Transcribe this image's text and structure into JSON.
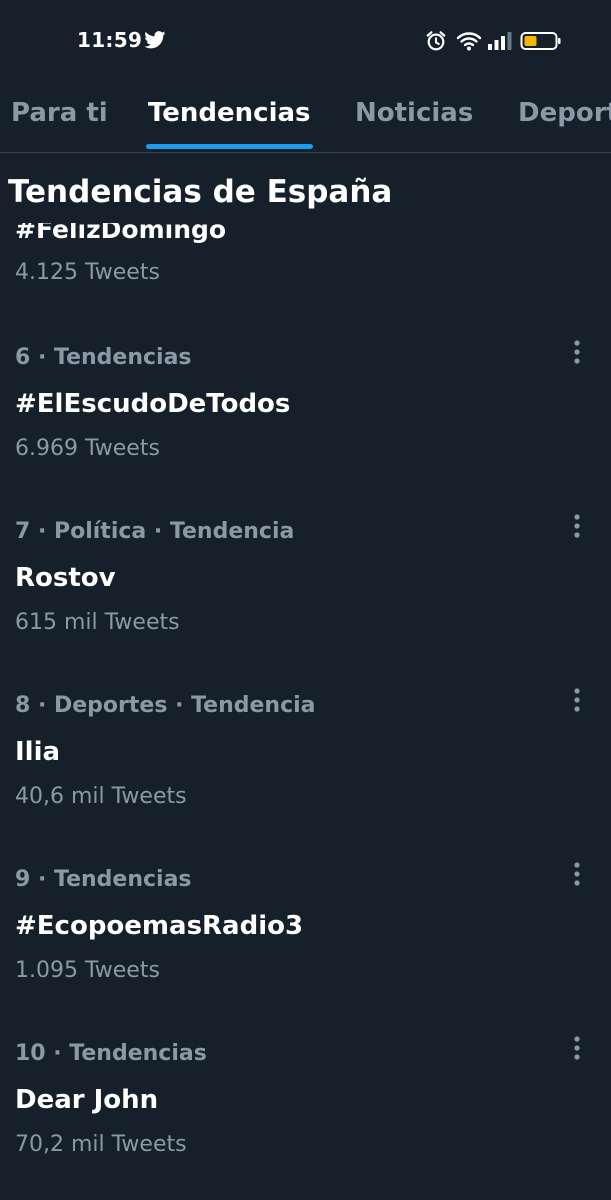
{
  "status_bar": {
    "time": "11:59",
    "icons": [
      "twitter-bird-icon",
      "alarm-icon",
      "wifi-icon",
      "signal-icon",
      "battery-icon"
    ],
    "battery_color": "#f5b800"
  },
  "tabs": [
    {
      "label": "Para ti",
      "active": false
    },
    {
      "label": "Tendencias",
      "active": true
    },
    {
      "label": "Noticias",
      "active": false
    },
    {
      "label": "Deportes",
      "active": false
    }
  ],
  "section_title": "Tendencias de España",
  "partial_trend": {
    "name": "#FelizDomingo",
    "count": "4.125 Tweets"
  },
  "trends": [
    {
      "meta": "6 · Tendencias",
      "name": "#ElEscudoDeTodos",
      "count": "6.969 Tweets"
    },
    {
      "meta": "7 · Política · Tendencia",
      "name": "Rostov",
      "count": "615 mil Tweets"
    },
    {
      "meta": "8 · Deportes · Tendencia",
      "name": "Ilia",
      "count": "40,6 mil Tweets"
    },
    {
      "meta": "9 · Tendencias",
      "name": "#EcopoemasRadio3",
      "count": "1.095 Tweets"
    },
    {
      "meta": "10 · Tendencias",
      "name": "Dear John",
      "count": "70,2 mil Tweets"
    }
  ],
  "colors": {
    "background": "#15202b",
    "accent": "#1d9bf0",
    "muted_text": "#8b98a5",
    "divider": "#38444d"
  }
}
